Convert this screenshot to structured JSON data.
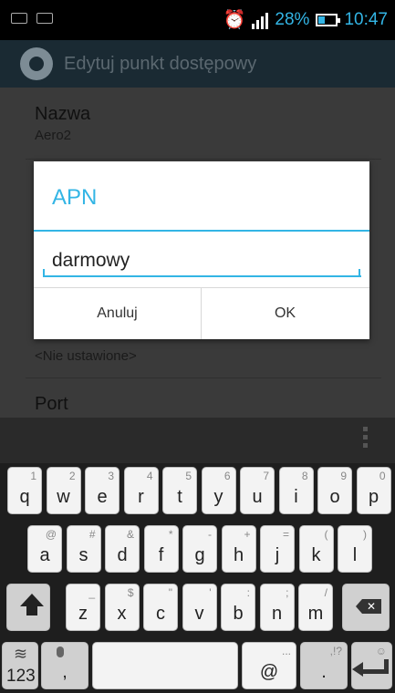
{
  "status_bar": {
    "battery": "28%",
    "time": "10:47"
  },
  "action_bar": {
    "title": "Edytuj punkt dostępowy",
    "icon": "settings-gear-icon"
  },
  "settings": [
    {
      "title": "Nazwa",
      "subtitle": "Aero2"
    },
    {
      "title": "",
      "subtitle": "<Nie ustawione>"
    },
    {
      "title": "Port",
      "subtitle": ""
    }
  ],
  "dialog": {
    "title": "APN",
    "input_value": "darmowy",
    "cancel_label": "Anuluj",
    "ok_label": "OK",
    "accent_color": "#33b5e5"
  },
  "keyboard": {
    "row1": [
      {
        "main": "q",
        "sec": "1"
      },
      {
        "main": "w",
        "sec": "2"
      },
      {
        "main": "e",
        "sec": "3"
      },
      {
        "main": "r",
        "sec": "4"
      },
      {
        "main": "t",
        "sec": "5"
      },
      {
        "main": "y",
        "sec": "6"
      },
      {
        "main": "u",
        "sec": "7"
      },
      {
        "main": "i",
        "sec": "8"
      },
      {
        "main": "o",
        "sec": "9"
      },
      {
        "main": "p",
        "sec": "0"
      }
    ],
    "row2": [
      {
        "main": "a",
        "sec": "@"
      },
      {
        "main": "s",
        "sec": "#"
      },
      {
        "main": "d",
        "sec": "&"
      },
      {
        "main": "f",
        "sec": "*"
      },
      {
        "main": "g",
        "sec": "-"
      },
      {
        "main": "h",
        "sec": "+"
      },
      {
        "main": "j",
        "sec": "="
      },
      {
        "main": "k",
        "sec": "("
      },
      {
        "main": "l",
        "sec": ")"
      }
    ],
    "row3": [
      {
        "main": "z",
        "sec": "_"
      },
      {
        "main": "x",
        "sec": "$"
      },
      {
        "main": "c",
        "sec": "\""
      },
      {
        "main": "v",
        "sec": "'"
      },
      {
        "main": "b",
        "sec": ":"
      },
      {
        "main": "n",
        "sec": ";"
      },
      {
        "main": "m",
        "sec": "/"
      }
    ],
    "numbers_label": "123",
    "comma_label": ",",
    "at_label": "@",
    "period_label": ".",
    "punct_hint": ",!?",
    "ellipsis_hint": "..."
  }
}
